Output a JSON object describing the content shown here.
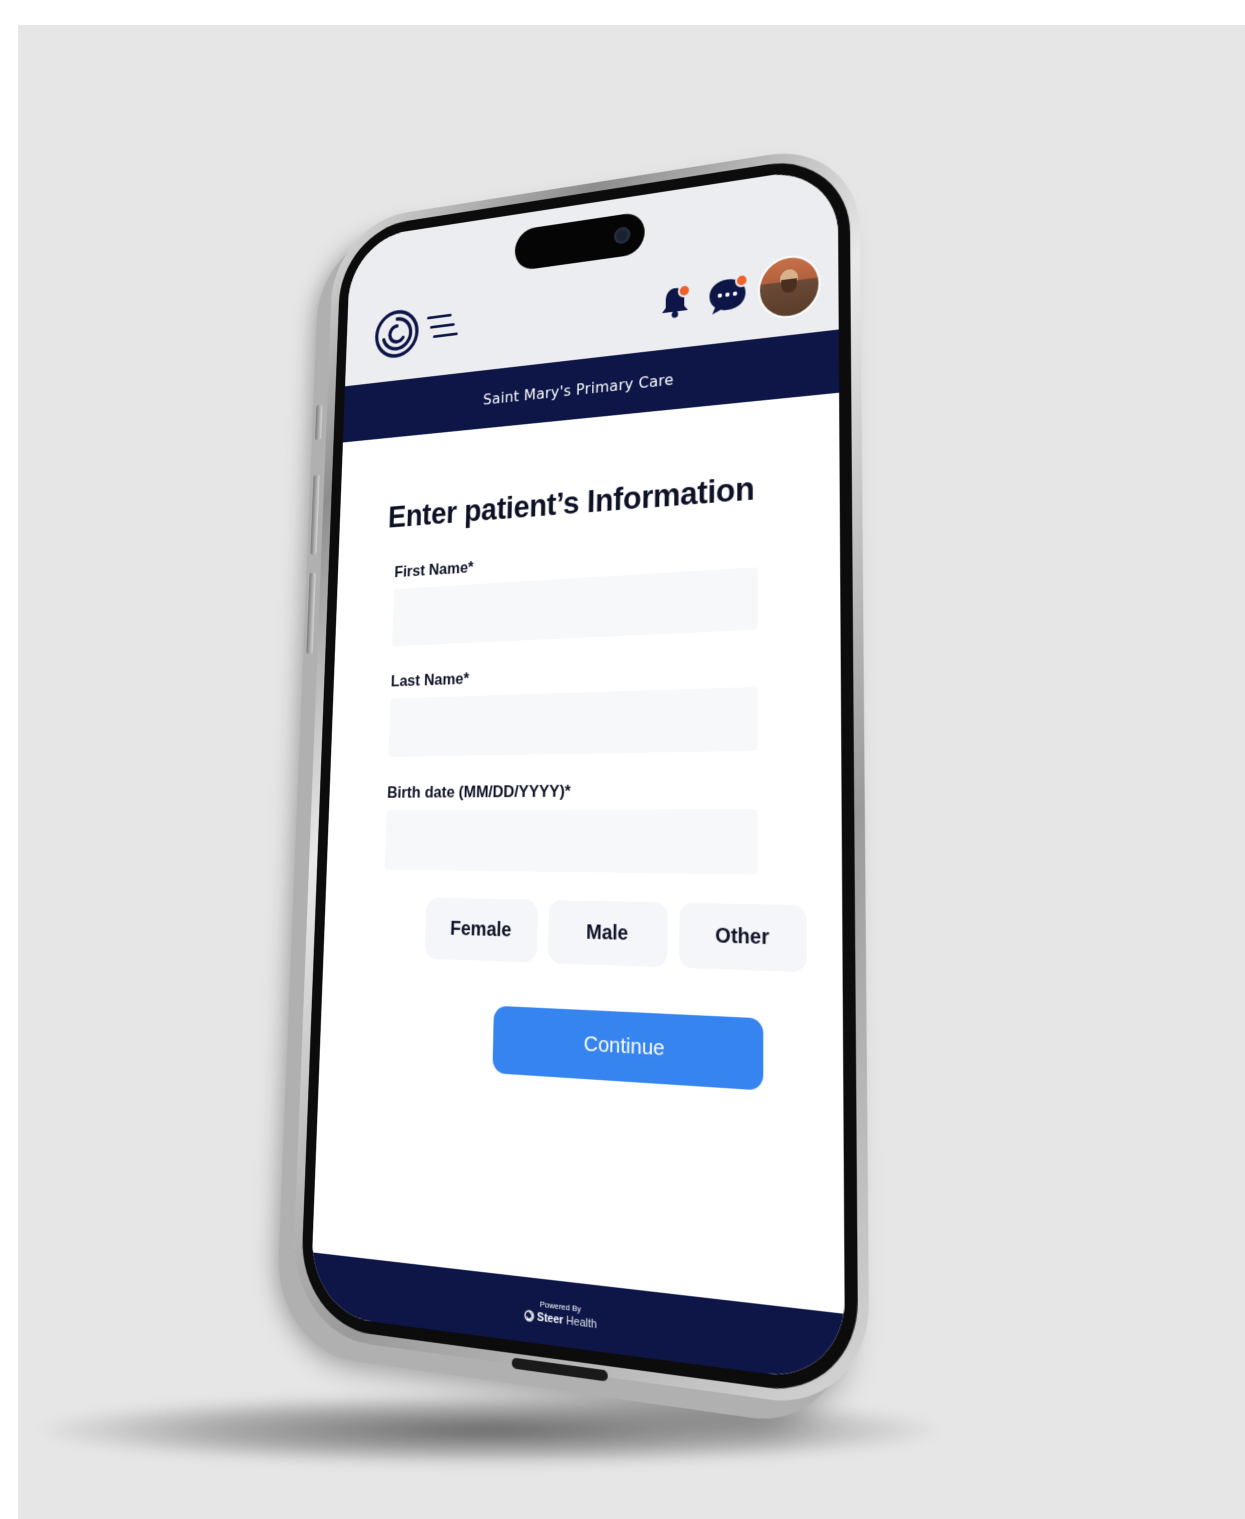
{
  "app": {
    "practice_name": "Saint Mary's Primary Care",
    "page_title": "Enter patient’s Information"
  },
  "header": {
    "icons": [
      "logo-icon",
      "menu-icon",
      "notification-bell-icon",
      "chat-icon",
      "avatar"
    ],
    "badge_color": "#f0602b",
    "background": "#ecedf0"
  },
  "form": {
    "first_name_label": "First Name*",
    "first_name_value": "",
    "last_name_label": "Last Name*",
    "last_name_value": "",
    "birth_date_label": "Birth date (MM/DD/YYYY)*",
    "birth_date_value": "",
    "gender_options": [
      "Female",
      "Male",
      "Other"
    ],
    "continue_label": "Continue"
  },
  "footer": {
    "powered_by": "Powered By",
    "brand_bold": "Steer",
    "brand_light": "Health"
  },
  "colors": {
    "navy": "#0e1648",
    "primary_button": "#3584f0",
    "field_bg": "#f7f8fa"
  }
}
